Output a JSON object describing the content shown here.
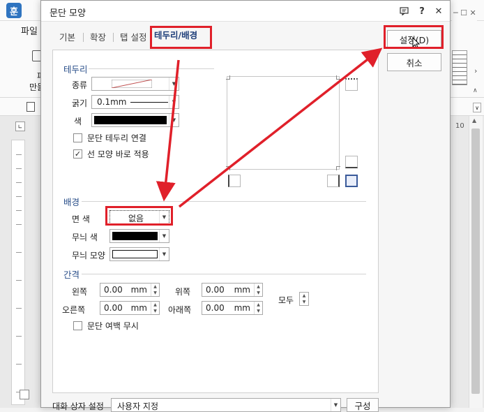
{
  "app": {
    "logo": "훈",
    "menu_label": "파일",
    "ribbon_partial_1": "파",
    "ribbon_partial_2": "만들",
    "ruler_number": "10"
  },
  "dialog": {
    "title": "문단 모양",
    "help_label": "?",
    "close_label": "✕",
    "tabs": [
      {
        "label": "기본"
      },
      {
        "label": "확장"
      },
      {
        "label": "탭 설정"
      },
      {
        "label": "테두리/배경",
        "active": true
      }
    ],
    "border_section": {
      "title": "테두리",
      "type_label": "종류",
      "thickness_label": "굵기",
      "thickness_value": "0.1mm",
      "color_label": "색",
      "checkbox_connect": {
        "label": "문단 테두리 연결",
        "checked": false
      },
      "checkbox_apply": {
        "label": "선 모양 바로 적용",
        "checked": true
      }
    },
    "background_section": {
      "title": "배경",
      "face_color_label": "면 색",
      "face_color_value": "없음",
      "pattern_color_label": "무늬 색",
      "pattern_shape_label": "무늬 모양"
    },
    "spacing_section": {
      "title": "간격",
      "left_label": "왼쪽",
      "left_value": "0.00",
      "right_label": "오른쪽",
      "right_value": "0.00",
      "top_label": "위쪽",
      "top_value": "0.00",
      "bottom_label": "아래쪽",
      "bottom_value": "0.00",
      "unit": "mm",
      "all_label": "모두",
      "ignore_margin": {
        "label": "문단 여백 무시",
        "checked": false
      }
    },
    "footer": {
      "dialog_set_label": "대화 상자 설정",
      "dialog_set_value": "사용자 지정",
      "compose_label": "구성"
    },
    "buttons": {
      "ok_label": "설정(D)",
      "cancel_label": "취소"
    }
  },
  "colors": {
    "annotation_red": "#e0202a",
    "section_title": "#2a4f8a",
    "active_tab": "#1f3f7a"
  }
}
